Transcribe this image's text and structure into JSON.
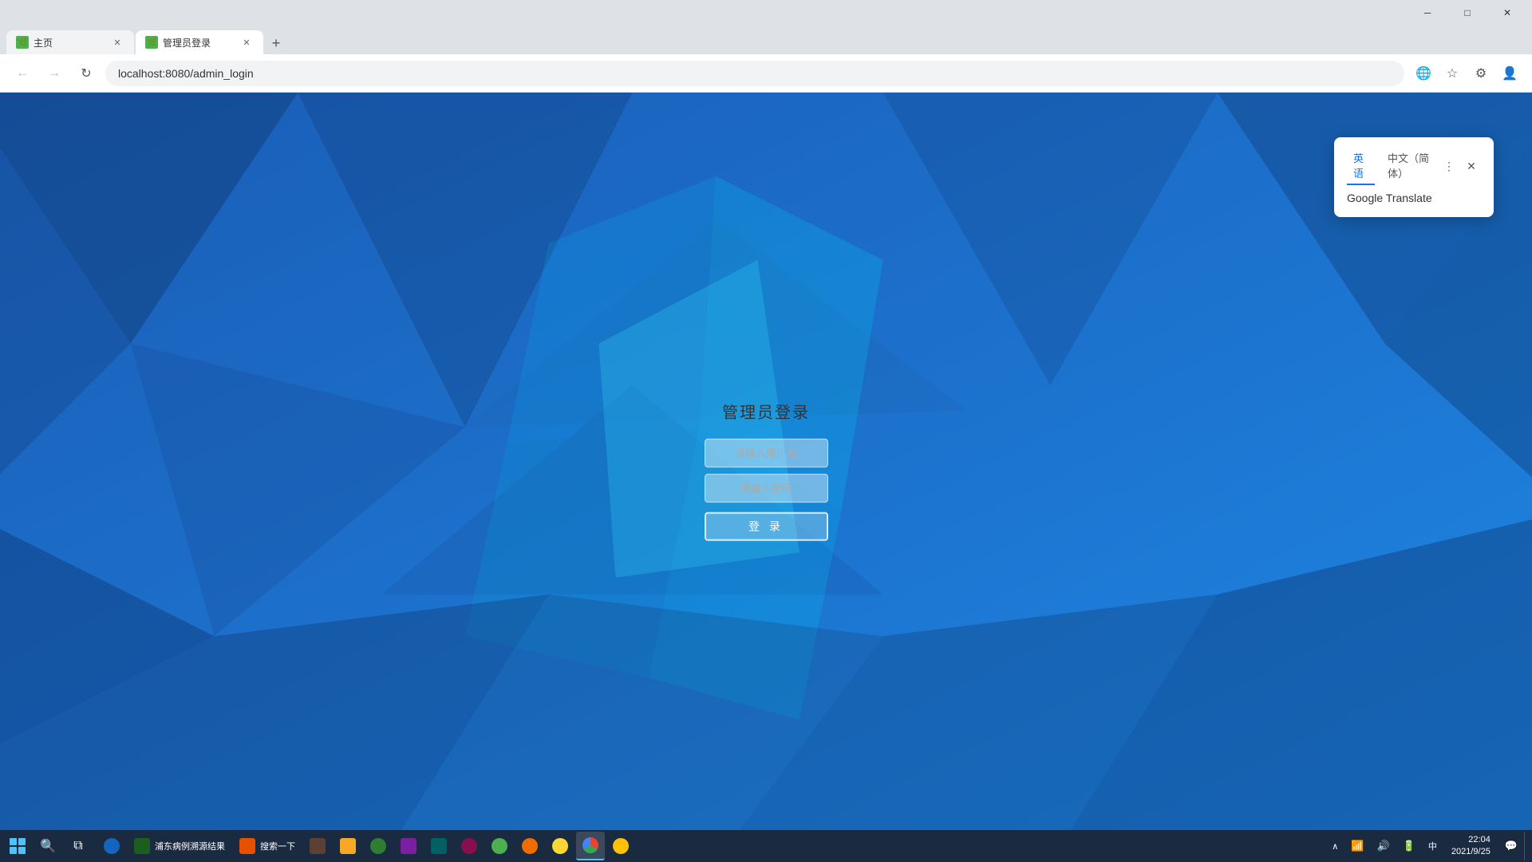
{
  "browser": {
    "tabs": [
      {
        "id": "tab1",
        "label": "主页",
        "active": false,
        "favicon": "green"
      },
      {
        "id": "tab2",
        "label": "管理员登录",
        "active": true,
        "favicon": "green"
      }
    ],
    "new_tab_label": "+",
    "url": "localhost:8080/admin_login",
    "nav": {
      "back": "←",
      "forward": "→",
      "refresh": "↻"
    }
  },
  "login": {
    "title": "管理员登录",
    "username_placeholder": "请输入用户名",
    "password_placeholder": "请输入密码",
    "submit_label": "登 录"
  },
  "translate_popup": {
    "visible": true,
    "tab_english": "英语",
    "tab_chinese": "中文（简体）",
    "label": "Google Translate",
    "more_icon": "⋮",
    "close_icon": "✕"
  },
  "taskbar": {
    "time": "22:04",
    "date": "2021/9/25",
    "apps": [
      {
        "label": "浦东病例溯源结果",
        "color": "icon-blue"
      },
      {
        "label": "搜索一下",
        "color": "icon-orange"
      },
      {
        "label": "",
        "color": "icon-green"
      },
      {
        "label": "",
        "color": "icon-yellow"
      },
      {
        "label": "",
        "color": "icon-teal"
      },
      {
        "label": "",
        "color": "icon-purple"
      },
      {
        "label": "",
        "color": "icon-lightblue"
      },
      {
        "label": "",
        "color": "icon-pink"
      },
      {
        "label": "",
        "color": "icon-red"
      },
      {
        "label": "",
        "color": "icon-green"
      },
      {
        "label": "",
        "color": "icon-blue"
      },
      {
        "label": "",
        "color": "icon-orange"
      }
    ],
    "sys_icons": [
      "🔊",
      "📶",
      "🔋",
      "💬"
    ]
  },
  "colors": {
    "bg_primary": "#1a6fd4",
    "bg_secondary": "#2196F3",
    "accent_cyan": "#00e5ff",
    "login_panel": "rgba(100,200,255,0.25)"
  }
}
